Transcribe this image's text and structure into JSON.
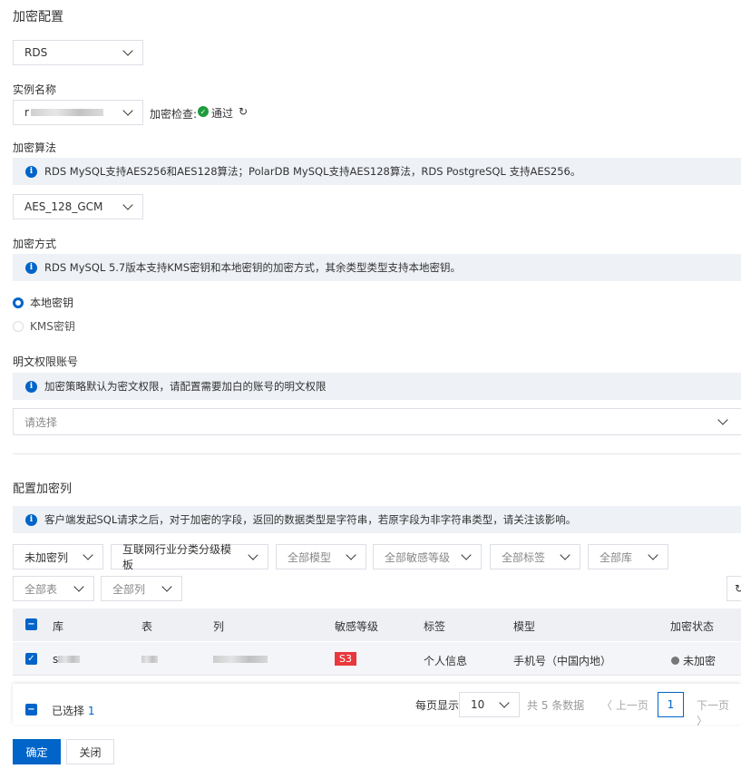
{
  "title": "加密配置",
  "db_type": "RDS",
  "instance": {
    "label": "实例名称",
    "value": "r",
    "check_label": "加密检查:",
    "check_status": "通过"
  },
  "algorithm": {
    "label": "加密算法",
    "info": "RDS MySQL支持AES256和AES128算法；PolarDB MySQL支持AES128算法，RDS PostgreSQL 支持AES256。",
    "value": "AES_128_GCM"
  },
  "method": {
    "label": "加密方式",
    "info": "RDS MySQL 5.7版本支持KMS密钥和本地密钥的加密方式，其余类型类型支持本地密钥。",
    "options": [
      "本地密钥",
      "KMS密钥"
    ],
    "selected": "本地密钥"
  },
  "plaintext": {
    "label": "明文权限账号",
    "info": "加密策略默认为密文权限，请配置需要加白的账号的明文权限",
    "placeholder": "请选择"
  },
  "columns_section": {
    "label": "配置加密列",
    "info": "客户端发起SQL请求之后，对于加密的字段，返回的数据类型是字符串，若原字段为非字符串类型，请关注该影响。"
  },
  "filters": [
    "未加密列",
    "互联网行业分类分级模板",
    "全部模型",
    "全部敏感等级",
    "全部标签",
    "全部库",
    "全部表",
    "全部列"
  ],
  "table": {
    "headers": [
      "库",
      "表",
      "列",
      "敏感等级",
      "标签",
      "模型",
      "加密状态"
    ],
    "rows": [
      {
        "db": "s",
        "table": "",
        "column": "",
        "level": "S3",
        "tag": "个人信息",
        "model": "手机号（中国内地）",
        "status": "未加密"
      }
    ]
  },
  "footer": {
    "selected_label": "已选择",
    "selected_count": "1",
    "page_size_label": "每页显示",
    "page_size": "10",
    "total": "共 5 条数据",
    "prev": "上一页",
    "page": "1",
    "next": "下一页"
  },
  "buttons": {
    "ok": "确定",
    "close": "关闭"
  },
  "colors": {
    "primary": "#0064c8",
    "danger": "#e8383d",
    "success": "#1e9c3c"
  }
}
